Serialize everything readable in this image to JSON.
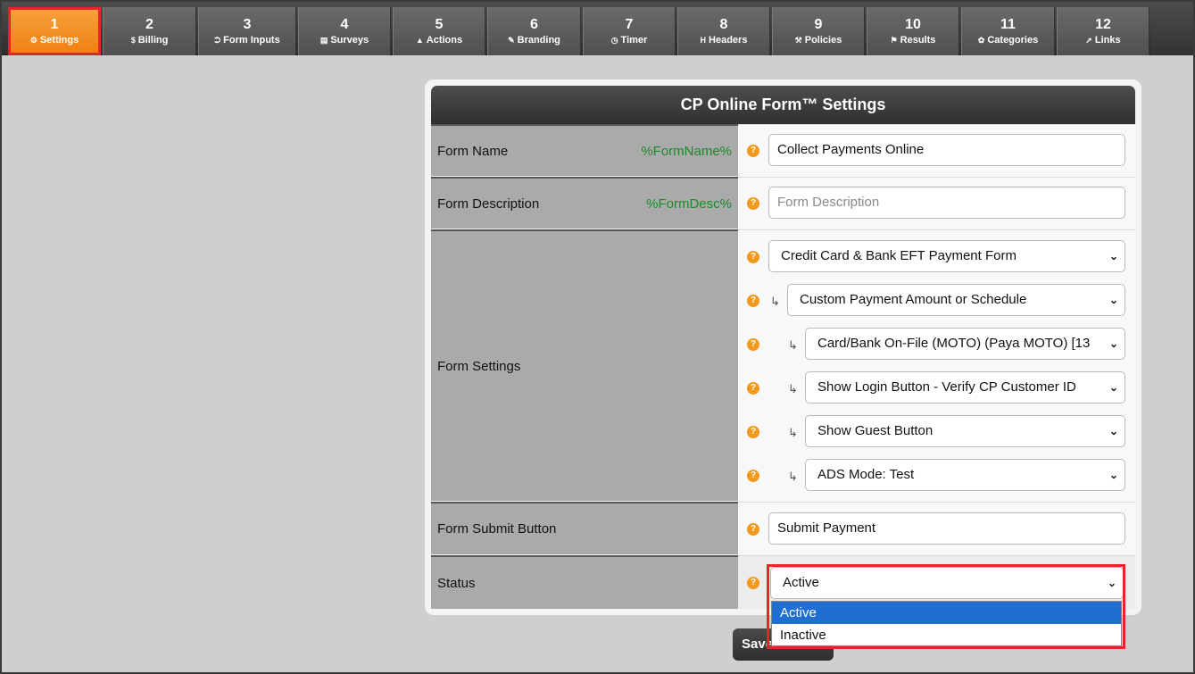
{
  "tabs": [
    {
      "num": "1",
      "label": "Settings",
      "icon": "⚙"
    },
    {
      "num": "2",
      "label": "Billing",
      "icon": "$"
    },
    {
      "num": "3",
      "label": "Form Inputs",
      "icon": "⮊"
    },
    {
      "num": "4",
      "label": "Surveys",
      "icon": "▤"
    },
    {
      "num": "5",
      "label": "Actions",
      "icon": "▲"
    },
    {
      "num": "6",
      "label": "Branding",
      "icon": "✎"
    },
    {
      "num": "7",
      "label": "Timer",
      "icon": "◷"
    },
    {
      "num": "8",
      "label": "Headers",
      "icon": "H"
    },
    {
      "num": "9",
      "label": "Policies",
      "icon": "⚒"
    },
    {
      "num": "10",
      "label": "Results",
      "icon": "⚑"
    },
    {
      "num": "11",
      "label": "Categories",
      "icon": "✿"
    },
    {
      "num": "12",
      "label": "Links",
      "icon": "➚"
    }
  ],
  "active_tab": "1",
  "panel": {
    "title": "CP Online Form™ Settings",
    "form_name": {
      "label": "Form Name",
      "var": "%FormName%",
      "value": "Collect Payments Online"
    },
    "form_description": {
      "label": "Form Description",
      "var": "%FormDesc%",
      "placeholder": "Form Description"
    },
    "form_settings": {
      "label": "Form Settings",
      "selects": [
        "Credit Card & Bank EFT Payment Form",
        "Custom Payment Amount or Schedule",
        "Card/Bank On-File (MOTO) (Paya MOTO) [13",
        "Show Login Button - Verify CP Customer ID",
        "Show Guest Button",
        "ADS Mode: Test"
      ]
    },
    "submit_button": {
      "label": "Form Submit Button",
      "value": "Submit Payment"
    },
    "status": {
      "label": "Status",
      "value": "Active",
      "options": [
        "Active",
        "Inactive"
      ]
    }
  },
  "save_button": "Save",
  "help_glyph": "?",
  "arrow_glyph": "↳",
  "chevron_glyph": "⌄",
  "colors": {
    "accent_orange": "#f29a1f",
    "highlight_red": "#e8242a",
    "var_green": "#1c8a2a",
    "selected_blue": "#1e6fd1"
  }
}
